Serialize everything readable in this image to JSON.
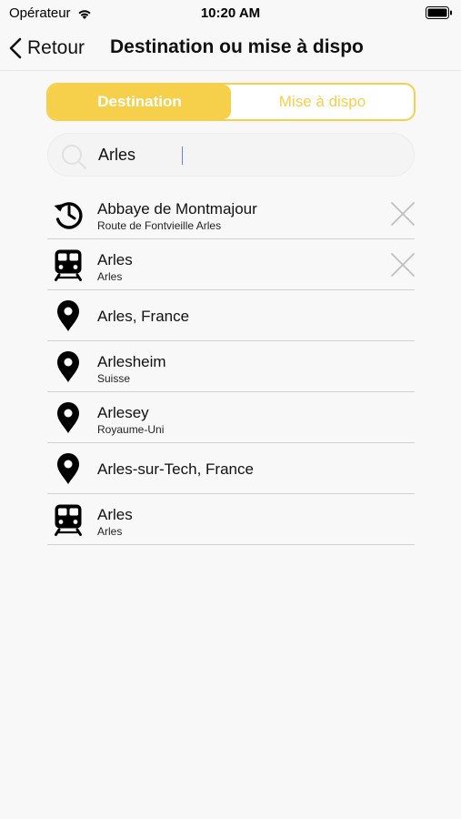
{
  "status": {
    "carrier": "Opérateur",
    "time": "10:20 AM"
  },
  "nav": {
    "back_label": "Retour",
    "title": "Destination ou mise à dispo"
  },
  "segments": [
    {
      "label": "Destination",
      "active": true
    },
    {
      "label": "Mise à dispo",
      "active": false
    }
  ],
  "search": {
    "value": "Arles"
  },
  "results": [
    {
      "icon": "history-icon",
      "name": "Abbaye de Montmajour",
      "subtitle": "Route de Fontvieille Arles",
      "removable": true
    },
    {
      "icon": "train-icon",
      "name": "Arles",
      "subtitle": "Arles",
      "removable": true
    },
    {
      "icon": "location-pin-icon",
      "name": "Arles, France",
      "subtitle": ""
    },
    {
      "icon": "location-pin-icon",
      "name": "Arlesheim",
      "subtitle": "Suisse"
    },
    {
      "icon": "location-pin-icon",
      "name": "Arlesey",
      "subtitle": "Royaume-Uni"
    },
    {
      "icon": "location-pin-icon",
      "name": "Arles-sur-Tech, France",
      "subtitle": ""
    },
    {
      "icon": "train-icon",
      "name": "Arles",
      "subtitle": "Arles"
    }
  ],
  "colors": {
    "accent": "#f6cf4b",
    "background": "#f8f8f8"
  }
}
